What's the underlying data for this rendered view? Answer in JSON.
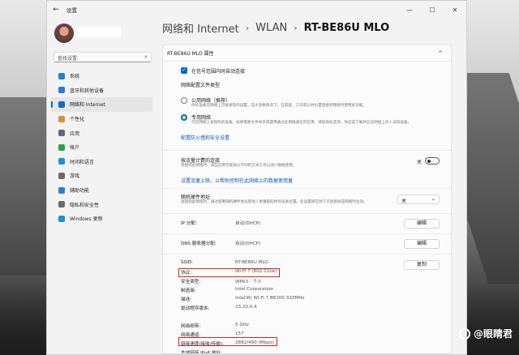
{
  "window": {
    "app_name": "设置"
  },
  "sidebar": {
    "search_placeholder": "查找设置",
    "items": [
      {
        "label": "系统",
        "icon": "system-icon",
        "color": "#2b7cd3"
      },
      {
        "label": "蓝牙和其他设备",
        "icon": "bluetooth-icon",
        "color": "#2b7cd3"
      },
      {
        "label": "网络和 Internet",
        "icon": "wifi-icon",
        "color": "#1b64c8",
        "active": true
      },
      {
        "label": "个性化",
        "icon": "brush-icon",
        "color": "#e08a3c"
      },
      {
        "label": "应用",
        "icon": "apps-icon",
        "color": "#5a6a8a"
      },
      {
        "label": "帐户",
        "icon": "account-icon",
        "color": "#2da04b"
      },
      {
        "label": "时间和语言",
        "icon": "globe-icon",
        "color": "#1f8fd6"
      },
      {
        "label": "游戏",
        "icon": "game-icon",
        "color": "#6a6a6a"
      },
      {
        "label": "辅助功能",
        "icon": "accessibility-icon",
        "color": "#2b7cd3"
      },
      {
        "label": "隐私和安全性",
        "icon": "shield-icon",
        "color": "#6a6a6a"
      },
      {
        "label": "Windows 更新",
        "icon": "update-icon",
        "color": "#1f8fd6"
      }
    ]
  },
  "breadcrumb": {
    "part1": "网络和 Internet",
    "sep": "›",
    "part2": "WLAN",
    "current": "RT-BE86U MLO"
  },
  "panel": {
    "title": "RT-BE86U MLO 属性",
    "auto_connect": "在信号范围内时自动连接",
    "profile_type_title": "网络配置文件类型",
    "public_label": "公用网络（推荐）",
    "public_desc": "你的设备在网络上可被发现的设置，在大多数情况下，在家庭、工作或公共位置连接到网络时使用此功能。",
    "private_label": "专用网络",
    "private_desc": "可在网络上发现你的设备，如果需要文件共享或使用通过此网络通信的应用，请选择此选项。你应该了解并信任网络上的人员和设备。",
    "firewall_link": "配置防火墙和安全设置",
    "metered_title": "按流量计费的连接",
    "metered_desc": "连接到此网络时，某些应用可能会以不同的方式工作以减少数据使用。",
    "metered_state": "关",
    "data_limit_link": "设置流量上限，以帮助控制在此网络上的数据使用量",
    "random_mac_title": "随机硬件地址",
    "random_mac_desc": "连接到此网络时，通过使用随机硬件地址使他人更难跟踪你的设备位置。此设置将在你下次连接到该网络时生效。",
    "random_mac_value": "关",
    "ip_label": "IP 分配:",
    "ip_value": "自动(DHCP)",
    "dns_label": "DNS 服务器分配:",
    "dns_value": "自动(DHCP)",
    "edit_label": "编辑",
    "copy_label": "复制",
    "props": [
      {
        "k": "SSID:",
        "v": "RT-BE86U MLO"
      },
      {
        "k": "协议:",
        "v": "Wi-Fi 7 (802.11be)"
      },
      {
        "k": "安全类型:",
        "v": "WPA3 - 个人"
      },
      {
        "k": "制造商:",
        "v": "Intel Corporation"
      },
      {
        "k": "描述:",
        "v": "Intel(R) Wi-Fi 7 BE200 320MHz"
      },
      {
        "k": "驱动程序版本:",
        "v": "23.20.0.4"
      },
      {
        "k": "网络频带:",
        "v": "5 GHz"
      },
      {
        "k": "网络通道:",
        "v": "157"
      },
      {
        "k": "链接速度(接收/传输):",
        "v": "2882/490 (Mbps)"
      },
      {
        "k": "本地链接 IPv6 地址:",
        "v": ""
      }
    ]
  },
  "watermark": "@眼睛君"
}
